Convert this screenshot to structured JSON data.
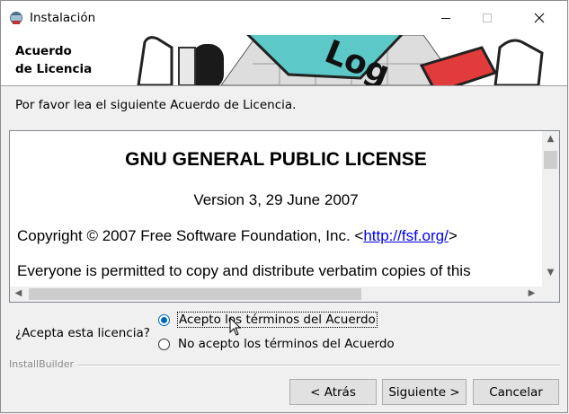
{
  "window": {
    "title": "Instalación"
  },
  "header": {
    "title": "Acuerdo\nde Licencia",
    "banner_text": "Log"
  },
  "instruction": "Por favor lea el siguiente Acuerdo de Licencia.",
  "license": {
    "heading": "GNU GENERAL PUBLIC LICENSE",
    "version": "Version 3, 29 June 2007",
    "copyright_prefix": "Copyright © 2007 Free Software Foundation, Inc. <",
    "copyright_link": "http://fsf.org/",
    "copyright_suffix": ">",
    "para1": "Everyone is permitted to copy and distribute verbatim copies of this"
  },
  "acceptance": {
    "question": "¿Acepta esta licencia?",
    "options": [
      {
        "label": "Acepto los términos del Acuerdo",
        "selected": true
      },
      {
        "label": "No acepto los términos del Acuerdo",
        "selected": false
      }
    ]
  },
  "footer": {
    "brand": "InstallBuilder",
    "back_label": "< Atrás",
    "next_label": "Siguiente >",
    "cancel_label": "Cancelar"
  },
  "colors": {
    "accent": "#0067c0",
    "banner_teal": "#5cc8c8",
    "banner_red": "#e23b3b"
  }
}
